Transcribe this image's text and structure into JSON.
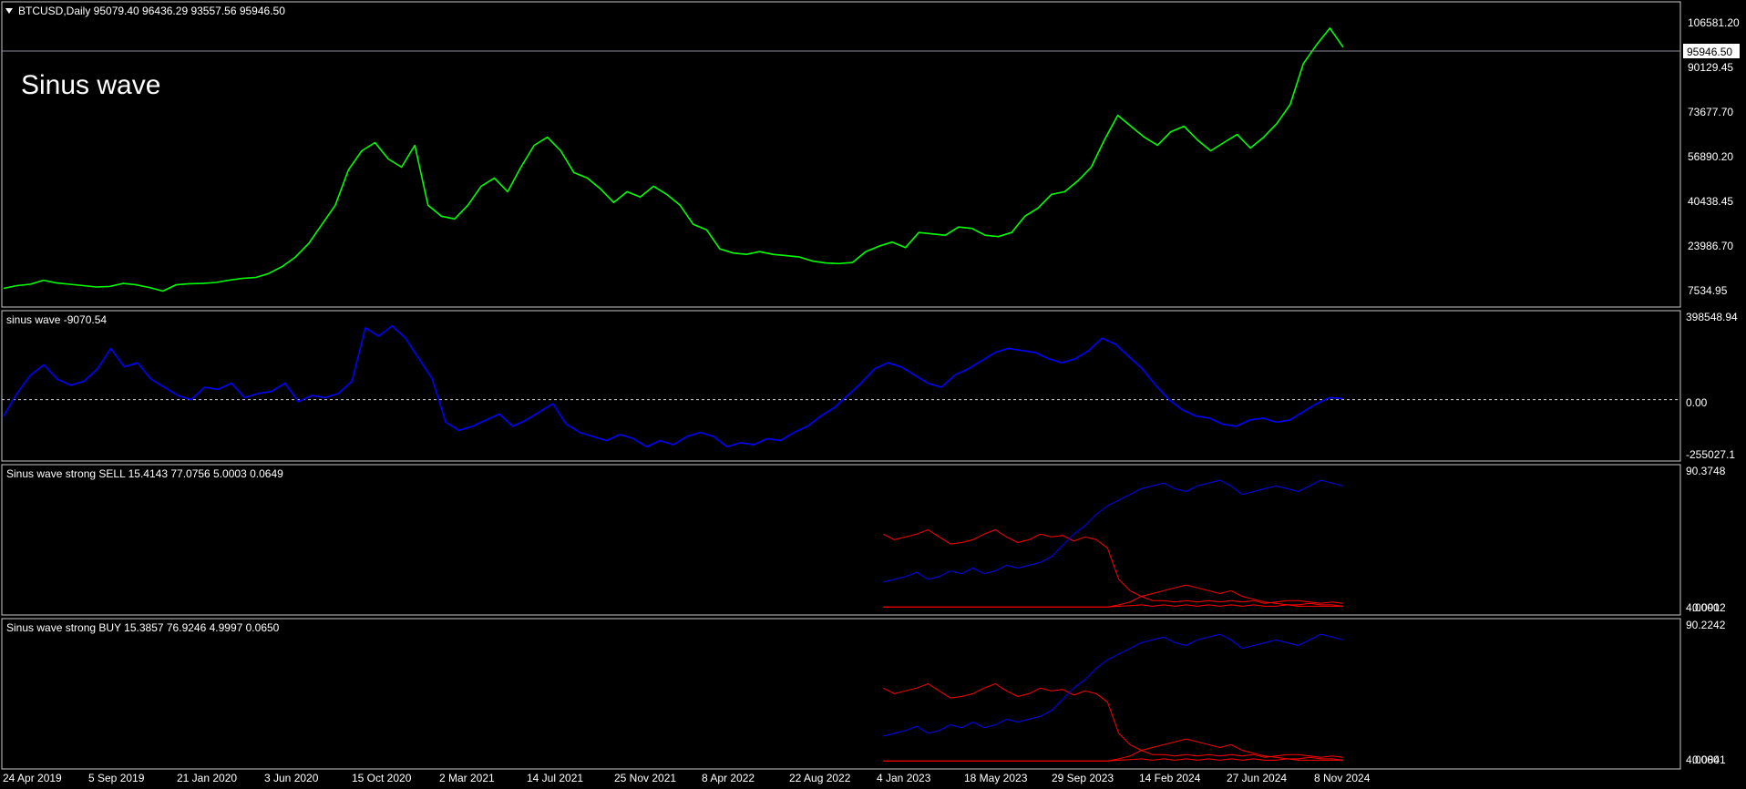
{
  "symbol_header": "BTCUSD,Daily  95079.40 96436.29 93557.56 95946.50",
  "overlay_text": "Sinus wave",
  "colors": {
    "background": "#000000",
    "frame": "#c8c8c8",
    "price": "#00ff00",
    "sinus": "#0000ff",
    "sell_buy_red": "#ff0000",
    "sell_buy_blue": "#0000ff",
    "text": "#ffffff"
  },
  "x_axis_labels": [
    "24 Apr 2019",
    "5 Sep 2019",
    "21 Jan 2020",
    "3 Jun 2020",
    "15 Oct 2020",
    "2 Mar 2021",
    "14 Jul 2021",
    "25 Nov 2021",
    "8 Apr 2022",
    "22 Aug 2022",
    "4 Jan 2023",
    "18 May 2023",
    "29 Sep 2023",
    "14 Feb 2024",
    "27 Jun 2024",
    "8 Nov 2024"
  ],
  "chart_data": [
    {
      "type": "line",
      "title": "BTCUSD,Daily",
      "current_price_label": "95946.50",
      "y_ticks": [
        "106581.20",
        "90129.45",
        "73677.70",
        "56890.20",
        "40438.45",
        "23986.70",
        "7534.95"
      ],
      "ylim": [
        4000,
        110000
      ],
      "series": [
        {
          "values": [
            7500,
            8500,
            9000,
            10500,
            9500,
            9000,
            8500,
            8000,
            8200,
            9300,
            8800,
            7800,
            6500,
            8800,
            9200,
            9300,
            9700,
            10500,
            11200,
            11500,
            13000,
            15500,
            19000,
            24000,
            31000,
            38000,
            51000,
            58000,
            61000,
            55000,
            52000,
            60000,
            38000,
            34000,
            33000,
            38000,
            45000,
            48000,
            43000,
            52000,
            60000,
            63000,
            58000,
            50000,
            48000,
            44000,
            39000,
            43000,
            41000,
            45000,
            42000,
            38000,
            31000,
            29000,
            22000,
            20500,
            20000,
            21000,
            20000,
            19500,
            19000,
            17500,
            16800,
            16600,
            17000,
            21000,
            23000,
            24500,
            22500,
            28000,
            27500,
            27000,
            30000,
            29500,
            27000,
            26500,
            28000,
            34000,
            37000,
            42000,
            43000,
            47000,
            52000,
            62000,
            71000,
            67000,
            63000,
            60000,
            65000,
            67000,
            62000,
            58000,
            61000,
            64000,
            59000,
            63000,
            68000,
            75000,
            90000,
            97000,
            103000,
            96000
          ]
        }
      ]
    },
    {
      "type": "line",
      "title": "sinus wave -9070.54",
      "y_ticks": [
        "398548.94",
        "0.00",
        "-255027.1"
      ],
      "ylim": [
        -255027.1,
        398548.94
      ],
      "zero_line": 0,
      "series": [
        {
          "values": [
            -80000,
            30000,
            120000,
            170000,
            100000,
            70000,
            90000,
            150000,
            250000,
            160000,
            180000,
            100000,
            60000,
            20000,
            0,
            60000,
            50000,
            80000,
            10000,
            30000,
            40000,
            80000,
            -10000,
            20000,
            10000,
            30000,
            90000,
            350000,
            310000,
            360000,
            300000,
            200000,
            100000,
            -110000,
            -150000,
            -130000,
            -100000,
            -70000,
            -130000,
            -100000,
            -60000,
            -20000,
            -120000,
            -160000,
            -180000,
            -200000,
            -170000,
            -190000,
            -230000,
            -200000,
            -220000,
            -180000,
            -160000,
            -180000,
            -230000,
            -210000,
            -220000,
            -190000,
            -200000,
            -160000,
            -130000,
            -80000,
            -40000,
            20000,
            80000,
            150000,
            180000,
            160000,
            120000,
            80000,
            60000,
            120000,
            150000,
            190000,
            230000,
            250000,
            240000,
            230000,
            200000,
            180000,
            200000,
            240000,
            300000,
            270000,
            210000,
            150000,
            70000,
            0,
            -50000,
            -80000,
            -90000,
            -120000,
            -130000,
            -100000,
            -90000,
            -110000,
            -100000,
            -60000,
            -20000,
            10000,
            5000
          ]
        }
      ]
    },
    {
      "type": "line",
      "title": "Sinus wave strong SELL 15.4143 77.0756 5.0003 0.0649",
      "y_ticks": [
        "90.3748",
        "0.0912"
      ],
      "y_tick_overlap_value": "4.0000",
      "ylim": [
        0,
        92
      ],
      "x_start_fraction": 0.525,
      "series": [
        {
          "values": [
            52,
            48,
            50,
            52,
            55,
            50,
            45,
            46,
            48,
            52,
            55,
            50,
            46,
            48,
            52,
            50,
            51,
            47,
            50,
            48,
            42,
            20,
            12,
            8,
            5,
            5,
            4,
            5,
            4,
            5,
            4,
            5,
            4,
            5,
            3,
            4,
            5,
            5,
            4,
            3,
            4,
            3
          ]
        },
        {
          "values": [
            18,
            20,
            22,
            25,
            20,
            22,
            26,
            24,
            28,
            24,
            26,
            30,
            28,
            30,
            32,
            36,
            44,
            52,
            58,
            66,
            72,
            76,
            80,
            84,
            86,
            88,
            84,
            82,
            86,
            88,
            90,
            86,
            80,
            82,
            84,
            86,
            84,
            82,
            86,
            90,
            88,
            86
          ]
        },
        {
          "values": [
            0.5,
            0.5,
            0.5,
            0.5,
            0.5,
            0.5,
            0.5,
            0.5,
            0.5,
            0.5,
            0.5,
            0.5,
            0.5,
            0.5,
            0.5,
            0.5,
            0.5,
            0.5,
            0.5,
            0.5,
            0.5,
            2,
            4,
            8,
            10,
            12,
            14,
            16,
            14,
            12,
            10,
            12,
            8,
            6,
            4,
            3,
            2,
            2,
            3,
            2,
            2,
            1
          ]
        },
        {
          "values": [
            0.5,
            0.5,
            0.5,
            0.5,
            0.5,
            0.5,
            0.5,
            0.5,
            0.5,
            0.5,
            0.5,
            0.5,
            0.5,
            0.5,
            0.5,
            0.5,
            0.5,
            0.5,
            0.5,
            0.5,
            0.5,
            1,
            1.5,
            2,
            1,
            2,
            1,
            2,
            1,
            2,
            1,
            2,
            1,
            2,
            1,
            1,
            2,
            1,
            1,
            1,
            1,
            1
          ]
        }
      ]
    },
    {
      "type": "line",
      "title": "Sinus wave strong BUY 15.3857 76.9246 4.9997 0.0650",
      "y_ticks": [
        "90.2242",
        "0.0841"
      ],
      "y_tick_overlap_value": "4.0000",
      "ylim": [
        0,
        92
      ],
      "x_start_fraction": 0.525,
      "series": [
        {
          "values": [
            52,
            48,
            50,
            52,
            55,
            50,
            45,
            46,
            48,
            52,
            55,
            50,
            46,
            48,
            52,
            50,
            51,
            47,
            50,
            48,
            42,
            20,
            12,
            8,
            5,
            5,
            4,
            5,
            4,
            5,
            4,
            5,
            4,
            5,
            3,
            4,
            5,
            5,
            4,
            3,
            4,
            3
          ]
        },
        {
          "values": [
            18,
            20,
            22,
            25,
            20,
            22,
            26,
            24,
            28,
            24,
            26,
            30,
            28,
            30,
            32,
            36,
            44,
            52,
            58,
            66,
            72,
            76,
            80,
            84,
            86,
            88,
            84,
            82,
            86,
            88,
            90,
            86,
            80,
            82,
            84,
            86,
            84,
            82,
            86,
            90,
            88,
            86
          ]
        },
        {
          "values": [
            0.5,
            0.5,
            0.5,
            0.5,
            0.5,
            0.5,
            0.5,
            0.5,
            0.5,
            0.5,
            0.5,
            0.5,
            0.5,
            0.5,
            0.5,
            0.5,
            0.5,
            0.5,
            0.5,
            0.5,
            0.5,
            2,
            4,
            8,
            10,
            12,
            14,
            16,
            14,
            12,
            10,
            12,
            8,
            6,
            4,
            3,
            2,
            2,
            3,
            2,
            2,
            1
          ]
        },
        {
          "values": [
            0.5,
            0.5,
            0.5,
            0.5,
            0.5,
            0.5,
            0.5,
            0.5,
            0.5,
            0.5,
            0.5,
            0.5,
            0.5,
            0.5,
            0.5,
            0.5,
            0.5,
            0.5,
            0.5,
            0.5,
            0.5,
            1,
            1.5,
            2,
            1,
            2,
            1,
            2,
            1,
            2,
            1,
            2,
            1,
            2,
            1,
            1,
            2,
            1,
            1,
            1,
            1,
            1
          ]
        }
      ]
    }
  ]
}
